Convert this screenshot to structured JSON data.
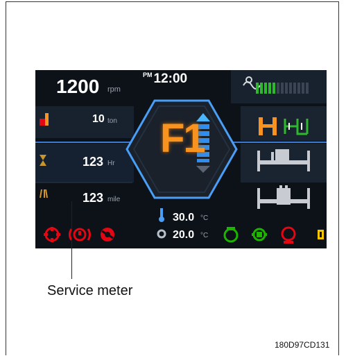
{
  "rpm": {
    "value": "1200",
    "unit": "rpm"
  },
  "clock": {
    "meridiem": "PM",
    "time": "12:00"
  },
  "load": {
    "value": "10",
    "unit": "ton"
  },
  "hours": {
    "value": "123",
    "unit": "Hr"
  },
  "distance": {
    "value": "123",
    "unit": "mile"
  },
  "gear": "F1",
  "temps": [
    {
      "value": "30.0",
      "unit": "°C"
    },
    {
      "value": "20.0",
      "unit": "°C"
    }
  ],
  "annotation": {
    "label": "Service meter"
  },
  "figure_code": "180D97CD131",
  "colors": {
    "accent_orange": "#f7931e",
    "warning_red": "#e30613",
    "ok_green": "#1db400",
    "fuel_green": "#2db82d",
    "frame_blue": "#3a7bd5"
  }
}
